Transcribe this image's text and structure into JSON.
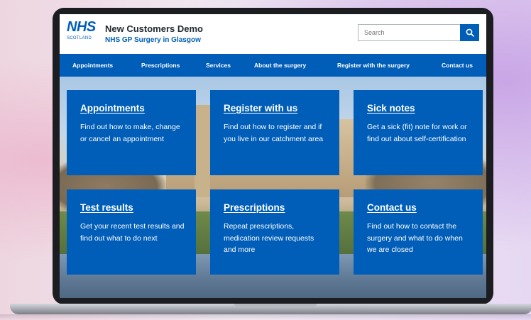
{
  "header": {
    "logo_text": "NHS",
    "logo_subtext": "SCOTLAND",
    "title": "New Customers Demo",
    "subtitle": "NHS GP Surgery in Glasgow"
  },
  "search": {
    "placeholder": "Search",
    "button_icon": "search-icon"
  },
  "nav": {
    "items": [
      {
        "label": "Appointments"
      },
      {
        "label": "Prescriptions"
      },
      {
        "label": "Services"
      },
      {
        "label": "About the surgery"
      },
      {
        "label": "Register with the surgery"
      },
      {
        "label": "Contact us"
      }
    ]
  },
  "cards": [
    {
      "title": "Appointments",
      "desc": "Find out how to make, change or cancel an appointment"
    },
    {
      "title": "Register with us",
      "desc": "Find out how to register and if you live in our catchment area"
    },
    {
      "title": "Sick notes",
      "desc": "Get a sick (fit) note for work or find out about self-certification"
    },
    {
      "title": "Test results",
      "desc": "Get your recent test results and find out what to do next"
    },
    {
      "title": "Prescriptions",
      "desc": "Repeat prescriptions, medication review requests and more"
    },
    {
      "title": "Contact us",
      "desc": "Find out how to contact the surgery and what to do when we are closed"
    }
  ],
  "colors": {
    "brand_blue": "#005eb8",
    "text_dark": "#212b32",
    "white": "#ffffff"
  }
}
